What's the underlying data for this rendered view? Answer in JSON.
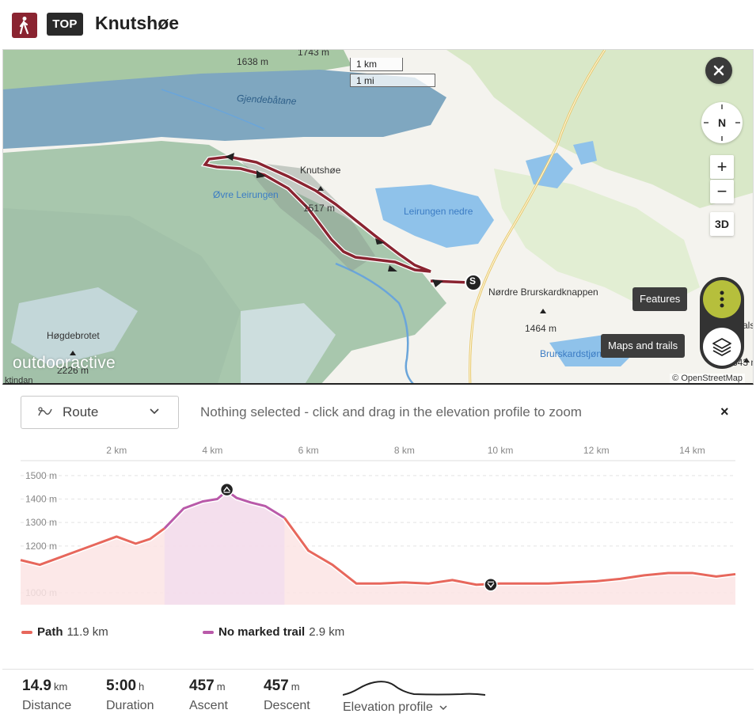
{
  "header": {
    "badge": "TOP",
    "title": "Knutshøe"
  },
  "map": {
    "scale_km": "1 km",
    "scale_mi": "1 mi",
    "labels": {
      "peak1": "1638 m",
      "peak2": "1743 m",
      "lake1": "Gjendebåtane",
      "knutshoe": "Knutshøe",
      "ovre": "Øvre Leirungen",
      "m1517": "1517 m",
      "leirungen_nedre": "Leirungen  nedre",
      "nordre": "Nørdre Brurskardknappen",
      "m1464": "1464 m",
      "brurskard": "Brurskardstjønn",
      "hogdebrotet": "Høgdebrotet",
      "m2226": "2226 m",
      "tindan": "ktindan",
      "als": "als",
      "m1843": "843 m"
    },
    "compass": "N",
    "zoom_in": "+",
    "zoom_out": "−",
    "btn_3d": "3D",
    "features_tooltip": "Features",
    "maps_tooltip": "Maps and trails",
    "osm": "© OpenStreetMap",
    "brand": "outdooractive",
    "start_marker": "S"
  },
  "profile_toolbar": {
    "route_label": "Route",
    "status": "Nothing selected - click and drag in the elevation profile to zoom",
    "close": "×"
  },
  "chart_data": {
    "type": "area",
    "x_ticks": [
      "2 km",
      "4 km",
      "6 km",
      "8 km",
      "10 km",
      "12 km",
      "14 km"
    ],
    "y_ticks": [
      "1500 m",
      "1400 m",
      "1300 m",
      "1200 m",
      "1000 m"
    ],
    "xlim_km": [
      0,
      14.9
    ],
    "ylim_m": [
      950,
      1550
    ],
    "series": [
      {
        "name": "Path",
        "color": "#e7675c",
        "x_km": [
          0,
          0.4,
          0.8,
          1.2,
          1.6,
          2.0,
          2.4,
          2.7,
          3.0
        ],
        "elev_m": [
          1140,
          1120,
          1150,
          1180,
          1210,
          1240,
          1210,
          1230,
          1275
        ]
      },
      {
        "name": "No marked trail",
        "color": "#b95aa9",
        "x_km": [
          3.0,
          3.4,
          3.8,
          4.1,
          4.3,
          4.5,
          4.8,
          5.1,
          5.5
        ],
        "elev_m": [
          1275,
          1360,
          1390,
          1400,
          1435,
          1405,
          1385,
          1370,
          1320
        ]
      },
      {
        "name": "Path",
        "color": "#e7675c",
        "x_km": [
          5.5,
          6.0,
          6.5,
          7.0,
          7.5,
          8.0,
          8.5,
          9.0,
          9.5,
          10.0,
          11.0,
          12.0,
          12.5,
          13.0,
          13.5,
          14.0,
          14.5,
          14.9
        ],
        "elev_m": [
          1320,
          1180,
          1120,
          1040,
          1040,
          1045,
          1040,
          1055,
          1035,
          1040,
          1040,
          1050,
          1060,
          1075,
          1085,
          1085,
          1070,
          1080
        ]
      }
    ],
    "markers": [
      {
        "type": "high-point",
        "x_km": 4.3,
        "elev_m": 1440
      },
      {
        "type": "low-point",
        "x_km": 9.8,
        "elev_m": 1035
      }
    ]
  },
  "legend": [
    {
      "name": "Path",
      "value": "11.9 km",
      "color": "#e7675c"
    },
    {
      "name": "No marked trail",
      "value": "2.9 km",
      "color": "#b95aa9"
    }
  ],
  "stats": {
    "distance": {
      "value": "14.9",
      "unit": "km",
      "label": "Distance"
    },
    "duration": {
      "value": "5:00",
      "unit": "h",
      "label": "Duration"
    },
    "ascent": {
      "value": "457",
      "unit": "m",
      "label": "Ascent"
    },
    "descent": {
      "value": "457",
      "unit": "m",
      "label": "Descent"
    },
    "elevation_profile_label": "Elevation profile"
  }
}
